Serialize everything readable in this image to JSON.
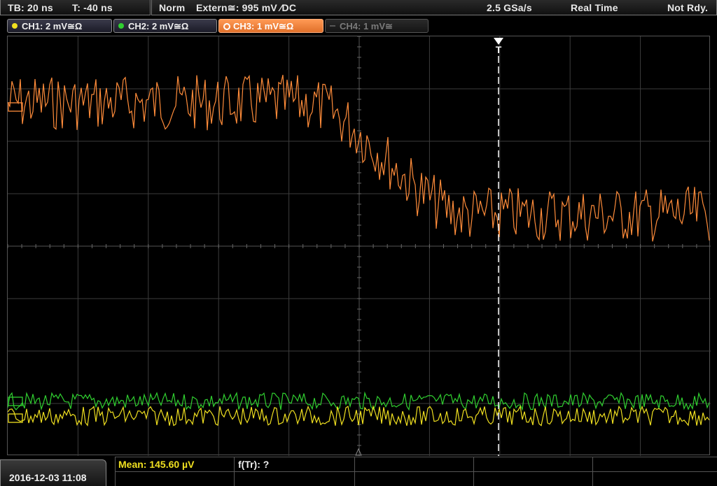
{
  "status": {
    "timebase": "TB: 20 ns",
    "trigger_offset": "T: -40 ns",
    "trigger_mode": "Norm",
    "trigger_source": "Extern≅: 995 mV ∕DC",
    "sample_rate": "2.5 GSa/s",
    "acq_mode": "Real Time",
    "run_state": "Not Rdy."
  },
  "channels": [
    {
      "label": "CH1: 2 mV≅Ω",
      "color": "#f0e020",
      "state": "on"
    },
    {
      "label": "CH2: 2 mV≅Ω",
      "color": "#30d030",
      "state": "on"
    },
    {
      "label": "CH3: 1 mV≅Ω",
      "color": "#ff8c3a",
      "state": "selected"
    },
    {
      "label": "CH4: 1 mV≅",
      "color": "#555555",
      "state": "off"
    }
  ],
  "trigger_marker": "T",
  "datetime": "2016-12-03 11:08",
  "measurements": {
    "mean": "Mean: 145.60 µV",
    "ftr": "f(Tr): ?"
  },
  "colors": {
    "ch1": "#f0e020",
    "ch2": "#30d030",
    "ch3": "#ff8c3a",
    "grid": "#3c3c3c",
    "meas_yellow": "#f0e020"
  }
}
